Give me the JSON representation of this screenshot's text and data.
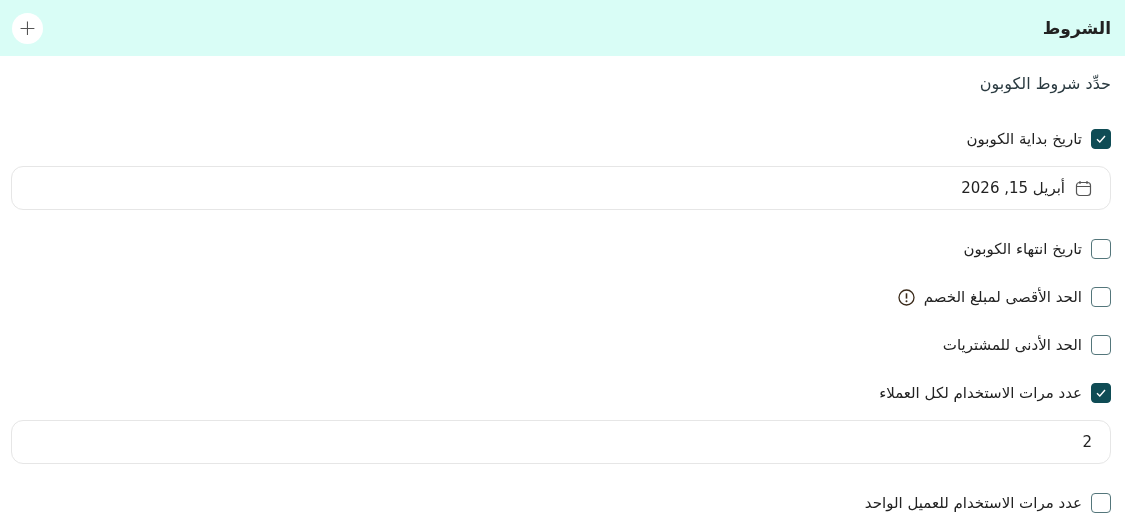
{
  "header": {
    "title": "الشروط",
    "add_button": "+"
  },
  "subtitle": "حدِّد شروط الكوبون",
  "conditions": [
    {
      "label": "تاريخ بداية الكوبون",
      "checked": true,
      "field": {
        "kind": "date",
        "value": "أبريل 15, 2026"
      }
    },
    {
      "label": "تاريخ انتهاء الكوبون",
      "checked": false
    },
    {
      "label": "الحد الأقصى لمبلغ الخصم",
      "checked": false,
      "info": true
    },
    {
      "label": "الحد الأدنى للمشتريات",
      "checked": false
    },
    {
      "label": "عدد مرات الاستخدام لكل العملاء",
      "checked": true,
      "field": {
        "kind": "number",
        "value": "2"
      }
    },
    {
      "label": "عدد مرات الاستخدام للعميل الواحد",
      "checked": false
    }
  ]
}
